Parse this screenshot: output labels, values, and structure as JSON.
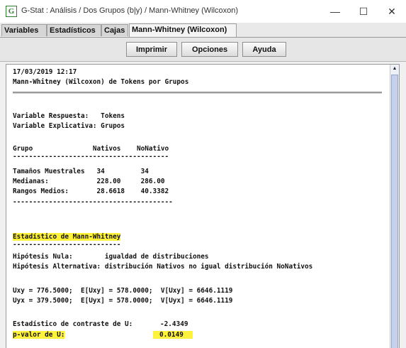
{
  "window": {
    "app_icon": "G",
    "title": "G-Stat : Análisis / Dos Grupos (b|y) / Mann-Whitney (Wilcoxon)",
    "minimize": "—",
    "maximize": "☐",
    "close": "✕"
  },
  "tabs": [
    {
      "label": "Variables",
      "active": false
    },
    {
      "label": "Estadísticos",
      "active": false
    },
    {
      "label": "Cajas",
      "active": false
    },
    {
      "label": "Mann-Whitney (Wilcoxon)",
      "active": true
    }
  ],
  "toolbar": {
    "print_label": "Imprimir",
    "options_label": "Opciones",
    "help_label": "Ayuda"
  },
  "report": {
    "datetime": "17/03/2019 12:17",
    "heading": "Mann-Whitney (Wilcoxon) de Tokens por Grupos",
    "response_var": "Variable Respuesta:   Tokens",
    "explanatory_var": "Variable Explicativa: Grupos",
    "table_header": "Grupo               Nativos    NoNativo",
    "dashes_table": "---------------------------------------",
    "rows": [
      "Tamaños Muestrales   34         34",
      "Medianas:            228.00     286.00",
      "Rangos Medios:       28.6618    40.3382"
    ],
    "dashes_after": "----------------------------------------",
    "stat_title": "Estadístico de Mann-Whitney",
    "stat_underline": "---------------------------",
    "null_hyp": "Hipótesis Nula:        igualdad de distribuciones",
    "alt_hyp": "Hipótesis Alternativa: distribución Nativos no igual distribución NoNativos",
    "uxy": "Uxy = 776.5000;  E[Uxy] = 578.0000;  V[Uxy] = 6646.1119",
    "uyx": "Uyx = 379.5000;  E[Uyx] = 578.0000;  V[Uyx] = 6646.1119",
    "contrast_label": "Estadístico de contraste de U:",
    "contrast_value": "-2.4349",
    "pvalue_label": "p-valor de U:",
    "pvalue_value": "0.0149",
    "highlight_color": "#fff23c"
  },
  "scrollbar": {
    "up_icon": "▲"
  }
}
